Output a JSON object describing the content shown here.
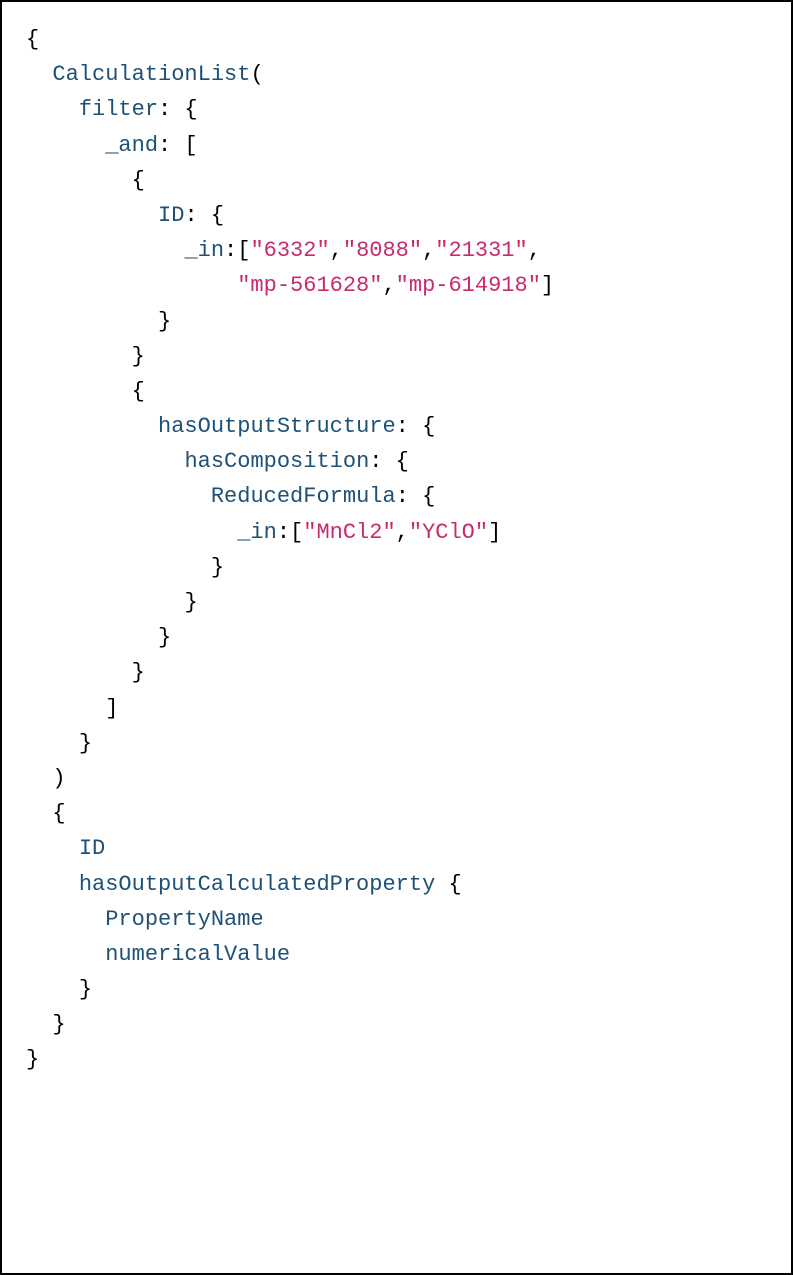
{
  "code": {
    "lines": [
      {
        "indent": 0,
        "segments": [
          {
            "text": "{",
            "class": "bracket"
          }
        ]
      },
      {
        "indent": 1,
        "segments": [
          {
            "text": "CalculationList",
            "class": "keyword"
          },
          {
            "text": "(",
            "class": "bracket"
          }
        ]
      },
      {
        "indent": 2,
        "segments": [
          {
            "text": "filter",
            "class": "keyword"
          },
          {
            "text": ": {",
            "class": "bracket"
          }
        ]
      },
      {
        "indent": 3,
        "segments": [
          {
            "text": "_and",
            "class": "keyword"
          },
          {
            "text": ": [",
            "class": "bracket"
          }
        ]
      },
      {
        "indent": 4,
        "segments": [
          {
            "text": "{",
            "class": "bracket"
          }
        ]
      },
      {
        "indent": 5,
        "segments": [
          {
            "text": "ID",
            "class": "keyword"
          },
          {
            "text": ": {",
            "class": "bracket"
          }
        ]
      },
      {
        "indent": 6,
        "segments": [
          {
            "text": "_in",
            "class": "keyword"
          },
          {
            "text": ":[",
            "class": "bracket"
          },
          {
            "text": "\"6332\"",
            "class": "string"
          },
          {
            "text": ",",
            "class": "bracket"
          },
          {
            "text": "\"8088\"",
            "class": "string"
          },
          {
            "text": ",",
            "class": "bracket"
          },
          {
            "text": "\"21331\"",
            "class": "string"
          },
          {
            "text": ",",
            "class": "bracket"
          }
        ]
      },
      {
        "indent": 8,
        "segments": [
          {
            "text": "\"mp-561628\"",
            "class": "string"
          },
          {
            "text": ",",
            "class": "bracket"
          },
          {
            "text": "\"mp-614918\"",
            "class": "string"
          },
          {
            "text": "]",
            "class": "bracket"
          }
        ]
      },
      {
        "indent": 5,
        "segments": [
          {
            "text": "}",
            "class": "bracket"
          }
        ]
      },
      {
        "indent": 4,
        "segments": [
          {
            "text": "}",
            "class": "bracket"
          }
        ]
      },
      {
        "indent": 4,
        "segments": [
          {
            "text": "{",
            "class": "bracket"
          }
        ]
      },
      {
        "indent": 5,
        "segments": [
          {
            "text": "hasOutputStructure",
            "class": "keyword"
          },
          {
            "text": ": {",
            "class": "bracket"
          }
        ]
      },
      {
        "indent": 6,
        "segments": [
          {
            "text": "hasComposition",
            "class": "keyword"
          },
          {
            "text": ": {",
            "class": "bracket"
          }
        ]
      },
      {
        "indent": 7,
        "segments": [
          {
            "text": "ReducedFormula",
            "class": "keyword"
          },
          {
            "text": ": {",
            "class": "bracket"
          }
        ]
      },
      {
        "indent": 8,
        "segments": [
          {
            "text": "_in",
            "class": "keyword"
          },
          {
            "text": ":[",
            "class": "bracket"
          },
          {
            "text": "\"MnCl2\"",
            "class": "string"
          },
          {
            "text": ",",
            "class": "bracket"
          },
          {
            "text": "\"YClO\"",
            "class": "string"
          },
          {
            "text": "]",
            "class": "bracket"
          }
        ]
      },
      {
        "indent": 7,
        "segments": [
          {
            "text": "}",
            "class": "bracket"
          }
        ]
      },
      {
        "indent": 6,
        "segments": [
          {
            "text": "}",
            "class": "bracket"
          }
        ]
      },
      {
        "indent": 5,
        "segments": [
          {
            "text": "}",
            "class": "bracket"
          }
        ]
      },
      {
        "indent": 4,
        "segments": [
          {
            "text": "}",
            "class": "bracket"
          }
        ]
      },
      {
        "indent": 3,
        "segments": [
          {
            "text": "]",
            "class": "bracket"
          }
        ]
      },
      {
        "indent": 2,
        "segments": [
          {
            "text": "}",
            "class": "bracket"
          }
        ]
      },
      {
        "indent": 1,
        "segments": [
          {
            "text": ")",
            "class": "bracket"
          }
        ]
      },
      {
        "indent": 1,
        "segments": [
          {
            "text": "{",
            "class": "bracket"
          }
        ]
      },
      {
        "indent": 2,
        "segments": [
          {
            "text": "ID",
            "class": "keyword"
          }
        ]
      },
      {
        "indent": 2,
        "segments": [
          {
            "text": "hasOutputCalculatedProperty",
            "class": "keyword"
          },
          {
            "text": " {",
            "class": "bracket"
          }
        ]
      },
      {
        "indent": 3,
        "segments": [
          {
            "text": "PropertyName",
            "class": "keyword"
          }
        ]
      },
      {
        "indent": 3,
        "segments": [
          {
            "text": "numericalValue",
            "class": "keyword"
          }
        ]
      },
      {
        "indent": 2,
        "segments": [
          {
            "text": "}",
            "class": "bracket"
          }
        ]
      },
      {
        "indent": 1,
        "segments": [
          {
            "text": "}",
            "class": "bracket"
          }
        ]
      },
      {
        "indent": 0,
        "segments": [
          {
            "text": "}",
            "class": "bracket"
          }
        ]
      }
    ]
  },
  "indentUnit": "  "
}
